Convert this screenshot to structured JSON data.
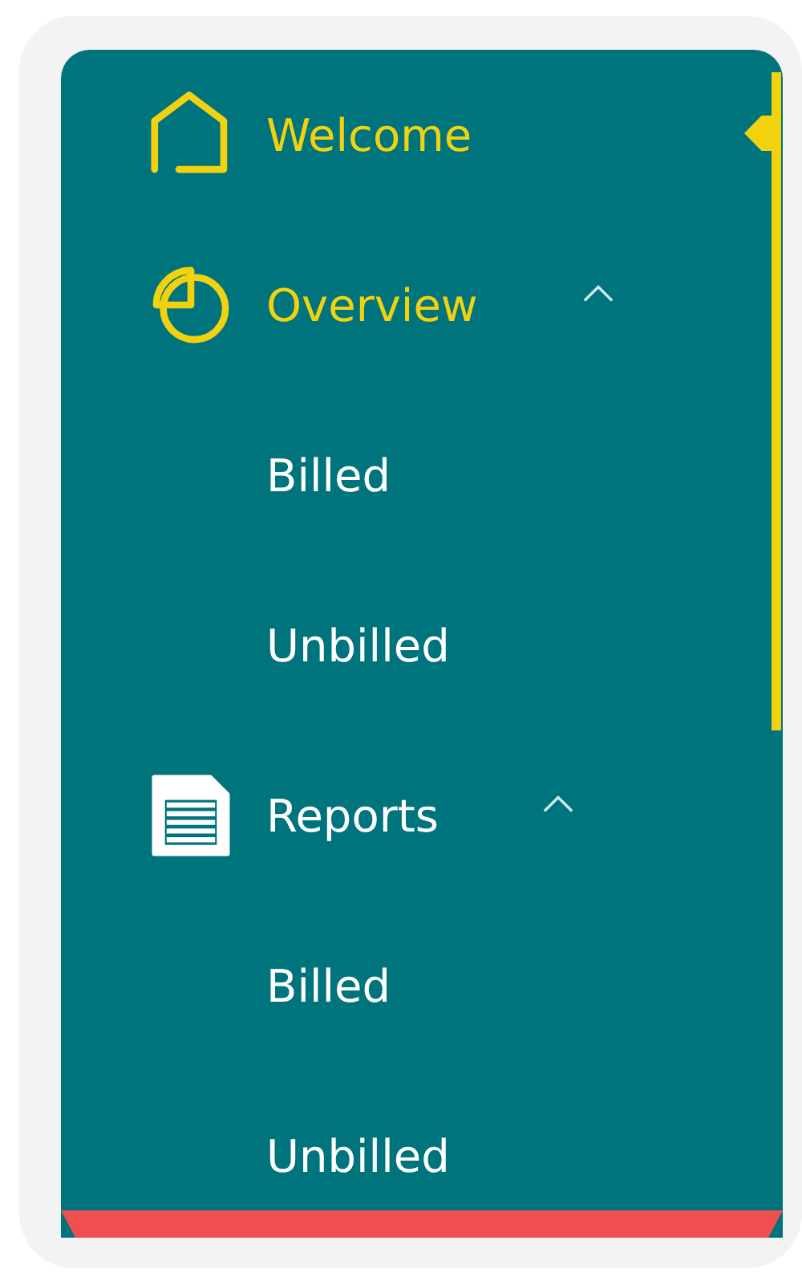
{
  "menu": [
    {
      "label": "Welcome",
      "kind": "home",
      "selected": true,
      "highlighted": true
    },
    {
      "label": "Overview",
      "kind": "pie",
      "selected": false,
      "highlighted": true,
      "expanded": true,
      "children": [
        {
          "label": "Billed",
          "selected": false,
          "highlighted": false
        },
        {
          "label": "Unbilled",
          "selected": false,
          "highlighted": false
        }
      ]
    },
    {
      "label": "Reports",
      "kind": "document",
      "selected": false,
      "highlighted": false,
      "expanded": true,
      "children": [
        {
          "label": "Billed",
          "selected": false,
          "highlighted": false
        },
        {
          "label": "Unbilled",
          "selected": false,
          "highlighted": false
        }
      ]
    }
  ]
}
